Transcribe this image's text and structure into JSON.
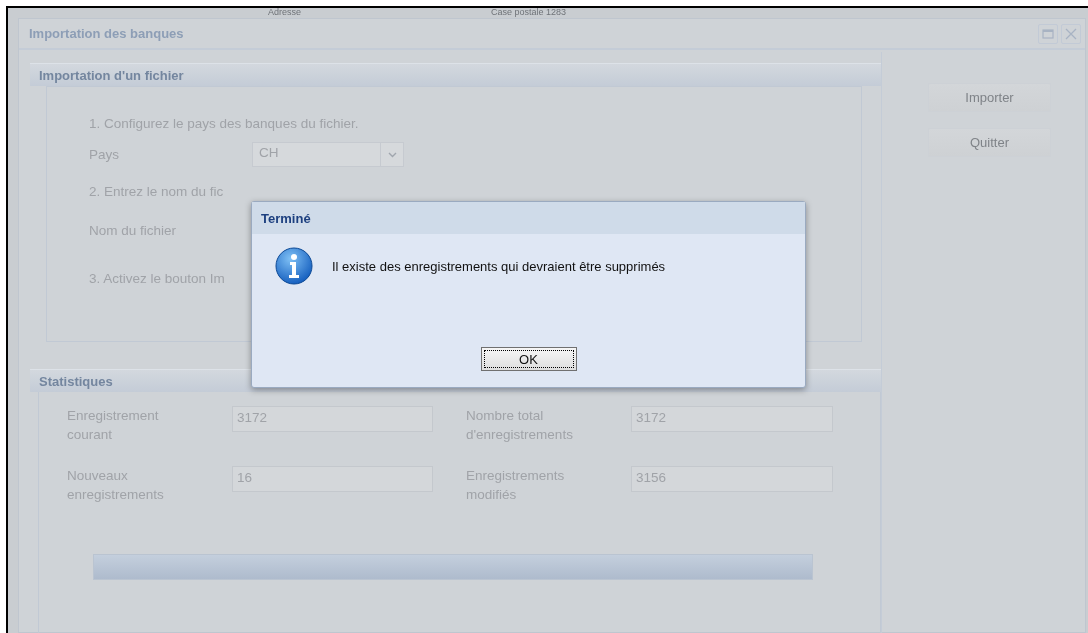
{
  "background_list": {
    "column_3": "Adresse",
    "column_4": "Case postale 1283"
  },
  "window": {
    "title": "Importation des banques"
  },
  "import_group": {
    "title": "Importation d'un fichier",
    "step_1": "1. Configurez le pays des banques du fichier.",
    "country_label": "Pays",
    "country_value": "CH",
    "step_2": "2. Entrez le nom du fic",
    "file_label": "Nom du fichier",
    "step_3": "3. Activez le bouton Im"
  },
  "buttons": [
    {
      "label": "Importer",
      "disabled": true
    },
    {
      "label": "Quitter",
      "disabled": true
    }
  ],
  "statistics": {
    "title": "Statistiques",
    "fields": [
      {
        "label": "Enregistrement courant",
        "value": "3172"
      },
      {
        "label": "Nombre total d'enregistrements",
        "value": "3172"
      },
      {
        "label": "Nouveaux enregistrements",
        "value": "16"
      },
      {
        "label": "Enregistrements modifiés",
        "value": "3156"
      }
    ],
    "progress": {
      "level": 1
    }
  },
  "dialog": {
    "title": "Terminé",
    "message": "Il existe des enregistrements qui devraient être supprimés",
    "button": "OK"
  }
}
